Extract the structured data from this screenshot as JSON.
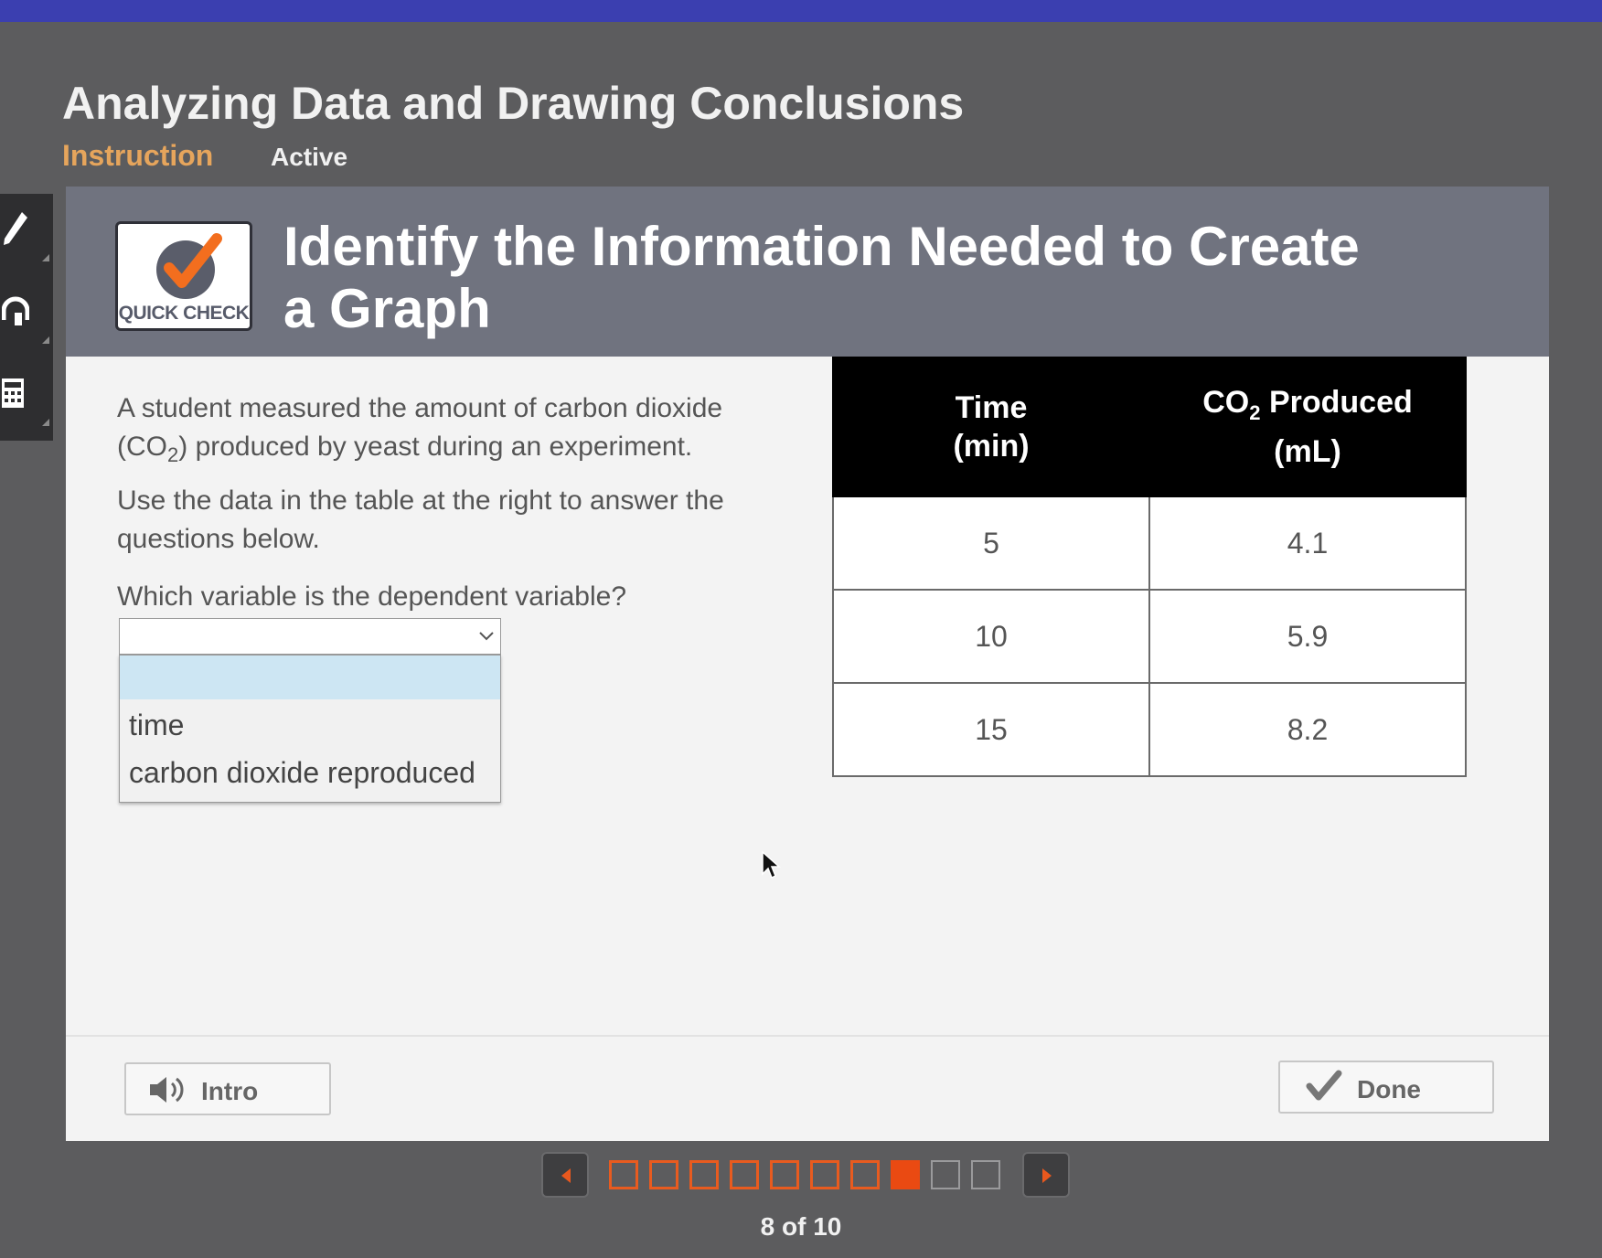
{
  "app": {
    "title": "Analyzing Data and Drawing Conclusions",
    "tabs": [
      "Instruction",
      "Active"
    ]
  },
  "toolbar": {
    "tools": [
      "pencil-icon",
      "headphones-icon",
      "calculator-icon"
    ]
  },
  "panel": {
    "badge_label": "QUICK CHECK",
    "title": "Identify the Information Needed to Create a Graph",
    "prompt": {
      "line1_before": "A student measured the amount of carbon dioxide (CO",
      "line1_sub": "2",
      "line1_after": ") produced by yeast during an experiment.",
      "line2": "Use the data in the table at the right to answer the questions below."
    },
    "question": "Which variable is the dependent variable?",
    "select": {
      "value": "",
      "options": [
        "",
        "time",
        "carbon dioxide reproduced"
      ]
    },
    "table": {
      "headers": [
        {
          "line1": "Time",
          "line2": "(min)"
        },
        {
          "line1_before": "CO",
          "line1_sub": "2",
          "line1_after": " Produced",
          "line2": "(mL)"
        }
      ],
      "rows": [
        [
          "5",
          "4.1"
        ],
        [
          "10",
          "5.9"
        ],
        [
          "15",
          "8.2"
        ]
      ]
    },
    "buttons": {
      "intro": "Intro",
      "done": "Done"
    }
  },
  "pager": {
    "current": 8,
    "total": 10,
    "label": "8 of 10"
  },
  "colors": {
    "accent_orange": "#ea4a12",
    "tab_instruction": "#e6a55c",
    "header_band": "#70737f",
    "top_bar": "#3b3fb0"
  }
}
